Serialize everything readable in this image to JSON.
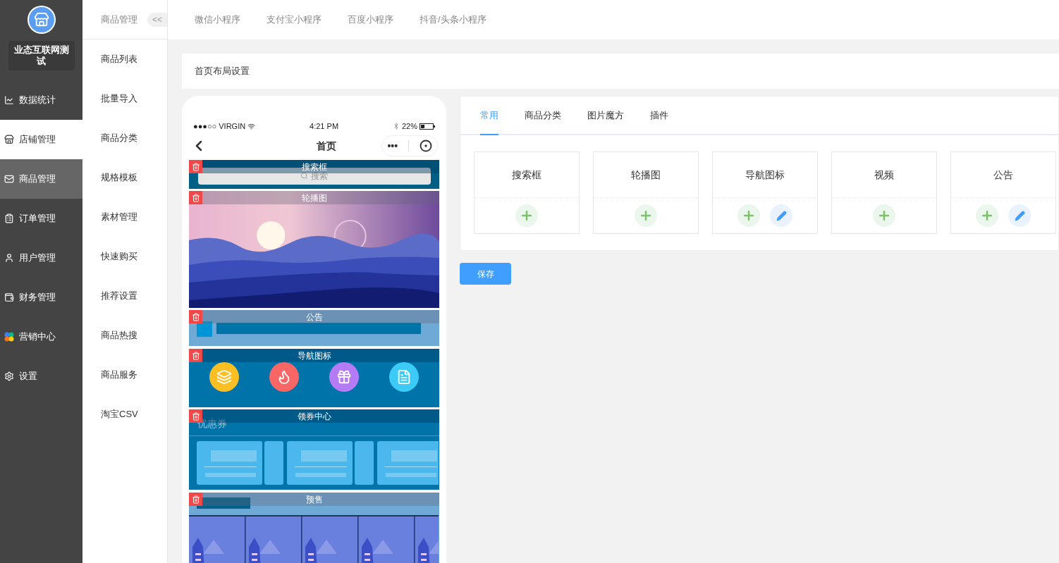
{
  "brand": {
    "name": "业态互联网测试"
  },
  "sidebar": {
    "items": [
      {
        "label": "数据统计",
        "selected": false,
        "hovered": false
      },
      {
        "label": "店铺管理",
        "selected": false,
        "hovered": true
      },
      {
        "label": "商品管理",
        "selected": true,
        "hovered": false
      },
      {
        "label": "订单管理",
        "selected": false,
        "hovered": false
      },
      {
        "label": "用户管理",
        "selected": false,
        "hovered": false
      },
      {
        "label": "财务管理",
        "selected": false,
        "hovered": false
      },
      {
        "label": "营销中心",
        "selected": false,
        "hovered": false
      },
      {
        "label": "设置",
        "selected": false,
        "hovered": false
      }
    ]
  },
  "submenu": {
    "title": "商品管理",
    "collapse": "<<",
    "items": [
      "商品列表",
      "批量导入",
      "商品分类",
      "规格模板",
      "素材管理",
      "快速购买",
      "推荐设置",
      "商品热搜",
      "商品服务",
      "淘宝CSV"
    ]
  },
  "top_tabs": [
    {
      "label": "微信小程序",
      "selected": false
    },
    {
      "label": "支付宝小程序",
      "selected": false
    },
    {
      "label": "百度小程序",
      "selected": false
    },
    {
      "label": "抖音/头条小程序",
      "selected": false
    }
  ],
  "page_title": "首页布局设置",
  "phone": {
    "carrier": "●●●○○ VIRGIN",
    "time": "4:21 PM",
    "battery": "22%",
    "title": "首页",
    "more": "•••",
    "modules": [
      {
        "kind": "search",
        "label": "搜索框",
        "placeholder": "搜索"
      },
      {
        "kind": "banner",
        "label": "轮播图"
      },
      {
        "kind": "notice",
        "label": "公告"
      },
      {
        "kind": "nav",
        "label": "导航图标",
        "icons": [
          {
            "color": "#fbbf24"
          },
          {
            "color": "#f86666"
          },
          {
            "color": "#b57bf5"
          },
          {
            "color": "#3ccbf7"
          }
        ]
      },
      {
        "kind": "coupon",
        "label": "领券中心",
        "caption": "优惠券"
      },
      {
        "kind": "presale",
        "label": "预售"
      }
    ]
  },
  "panel": {
    "tabs": [
      {
        "label": "常用",
        "selected": true
      },
      {
        "label": "商品分类",
        "selected": false
      },
      {
        "label": "图片魔方",
        "selected": false
      },
      {
        "label": "插件",
        "selected": false
      }
    ],
    "widgets": [
      {
        "label": "搜索框",
        "editable": false
      },
      {
        "label": "轮播图",
        "editable": false
      },
      {
        "label": "导航图标",
        "editable": true
      },
      {
        "label": "视频",
        "editable": false
      },
      {
        "label": "公告",
        "editable": true
      }
    ]
  },
  "save_button": "保存"
}
